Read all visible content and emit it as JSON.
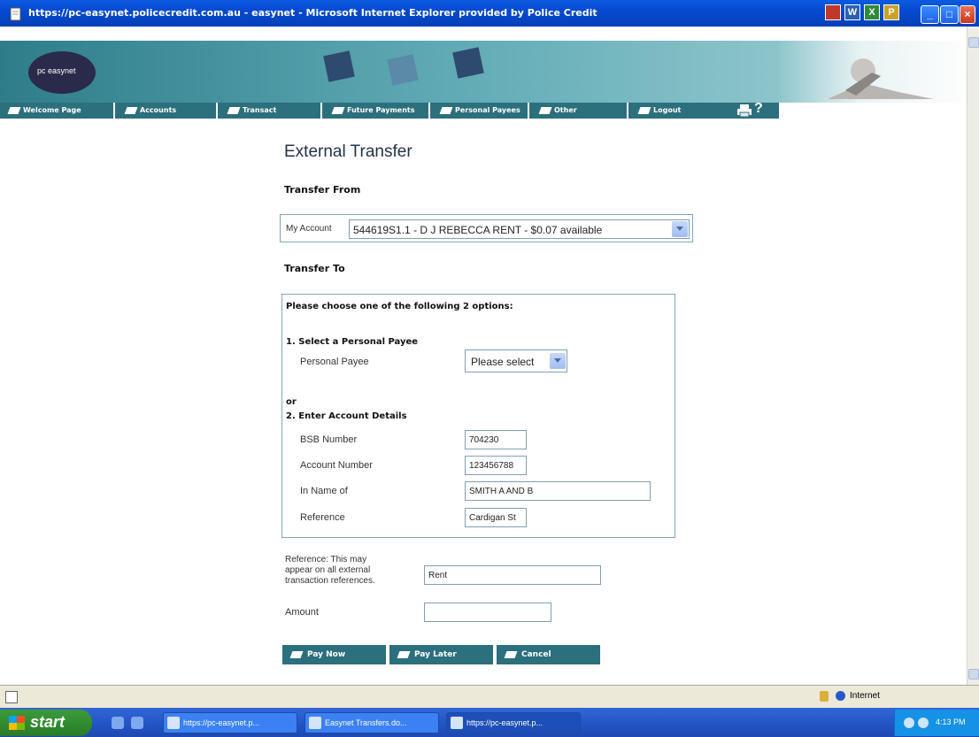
{
  "window": {
    "title": "https://pc-easynet.policecredit.com.au - easynet - Microsoft Internet Explorer provided by Police Credit",
    "minimize_icon": "minimize-icon",
    "maximize_icon": "maximize-icon",
    "close_icon": "close-icon"
  },
  "banner": {
    "logo_text": "pc easynet"
  },
  "nav": {
    "items": [
      {
        "label": "Welcome Page"
      },
      {
        "label": "Accounts"
      },
      {
        "label": "Transact"
      },
      {
        "label": "Future Payments"
      },
      {
        "label": "Personal Payees"
      },
      {
        "label": "Other"
      },
      {
        "label": "Logout"
      }
    ],
    "help_label": "?"
  },
  "page": {
    "title": "External Transfer",
    "transfer_from_label": "Transfer From",
    "my_account_label": "My Account",
    "account_selected": "544619S1.1 - D J REBECCA RENT - $0.07 available",
    "transfer_to_label": "Transfer To",
    "options_heading": "Please choose one of the following 2 options:",
    "option1_heading": "1. Select a Personal Payee",
    "personal_payee_label": "Personal Payee",
    "personal_payee_value": "Please select",
    "or_label": "or",
    "option2_heading": "2. Enter Account Details",
    "bsb_label": "BSB Number",
    "bsb_value": "704230",
    "account_number_label": "Account Number",
    "account_number_value": "123456788",
    "in_name_label": "In Name of",
    "in_name_value": "SMITH A AND B",
    "reference_label": "Reference",
    "reference_value": "Cardigan St",
    "ref_note_line1": "Reference: This may",
    "ref_note_line2": "appear on all external",
    "ref_note_line3": "transaction references.",
    "ref_note_value": "Rent",
    "amount_label": "Amount",
    "amount_value": ""
  },
  "buttons": {
    "pay_now": "Pay Now",
    "pay_later": "Pay Later",
    "cancel": "Cancel"
  },
  "statusbar": {
    "zone": "Internet"
  },
  "taskbar": {
    "start_label": "start",
    "tasks": [
      {
        "label": "https://pc-easynet.p..."
      },
      {
        "label": "Easynet Transfers.do..."
      },
      {
        "label": "https://pc-easynet.p..."
      }
    ],
    "clock": "4:13 PM"
  },
  "colors": {
    "nav_bg": "#2c6f7d",
    "title_bar": "#0649d0",
    "page_title": "#22344a",
    "box_border": "#7fa7b5"
  }
}
